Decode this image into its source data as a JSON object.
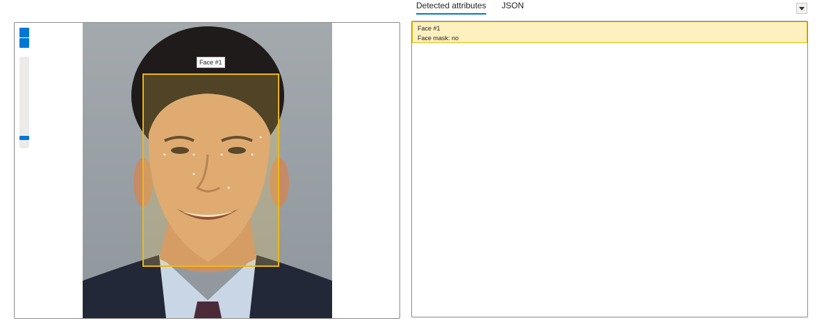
{
  "tabs": [
    {
      "label": "Detected attributes",
      "active": true
    },
    {
      "label": "JSON",
      "active": false
    }
  ],
  "zoom": {
    "level": 0.05
  },
  "faces": [
    {
      "label": "Face #1",
      "attributes": [
        {
          "text": "Face mask: no"
        }
      ]
    }
  ],
  "colors": {
    "accent": "#0078d4",
    "face_box": "#f2b70d",
    "highlight": "#fff0c0"
  }
}
